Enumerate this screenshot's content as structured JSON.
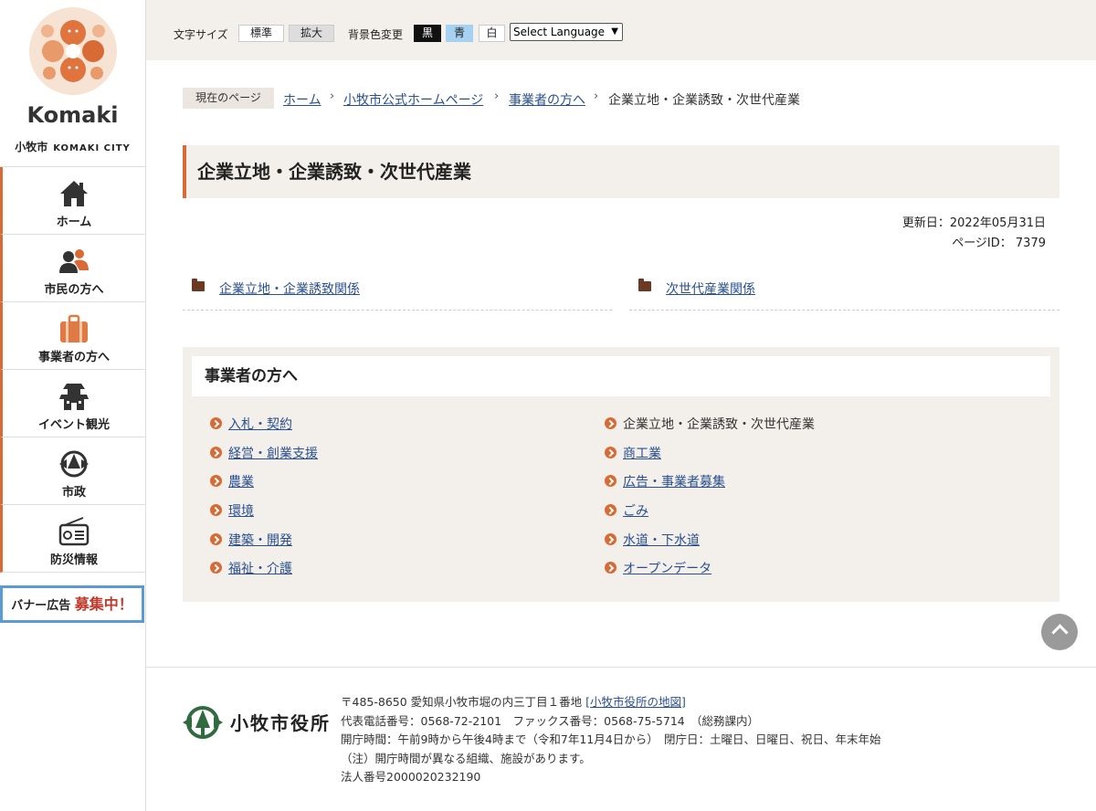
{
  "sidebar": {
    "logo_text": "Komaki",
    "logo_city_ja": "小牧市",
    "logo_city_en": "KOMAKI CITY",
    "nav": [
      {
        "label": "ホーム",
        "icon": "home-icon"
      },
      {
        "label": "市民の方へ",
        "icon": "people-icon"
      },
      {
        "label": "事業者の方へ",
        "icon": "briefcase-icon"
      },
      {
        "label": "イベント観光",
        "icon": "castle-icon"
      },
      {
        "label": "市政",
        "icon": "city-emblem-icon"
      },
      {
        "label": "防災情報",
        "icon": "radio-icon"
      }
    ],
    "banner_prefix": "バナー広告",
    "banner_highlight": "募集中！"
  },
  "topbar": {
    "font_size_label": "文字サイズ",
    "font_standard": "標準",
    "font_large": "拡大",
    "bg_label": "背景色変更",
    "bg_black": "黒",
    "bg_blue": "青",
    "bg_white": "白",
    "language": "Select Language"
  },
  "breadcrumb": {
    "label": "現在のページ",
    "items": [
      "ホーム",
      "小牧市公式ホームページ",
      "事業者の方へ"
    ],
    "current": "企業立地・企業誘致・次世代産業"
  },
  "page": {
    "title": "企業立地・企業誘致・次世代産業",
    "updated": "更新日：2022年05月31日",
    "page_id": "ページID： 7379",
    "folders": [
      "企業立地・企業誘致関係",
      "次世代産業関係"
    ]
  },
  "box": {
    "heading": "事業者の方へ",
    "left": [
      "入札・契約",
      "経営・創業支援",
      "農業",
      "環境",
      "建築・開発",
      "福祉・介護"
    ],
    "right": [
      "企業立地・企業誘致・次世代産業",
      "商工業",
      "広告・事業者募集",
      "ごみ",
      "水道・下水道",
      "オープンデータ"
    ]
  },
  "footer": {
    "name": "小牧市役所",
    "address": "〒485-8650 愛知県小牧市堀の内三丁目１番地",
    "map_link": "[小牧市役所の地図]",
    "phone": "代表電話番号：0568-72-2101　ファックス番号：0568-75-5714　（総務課内）",
    "hours": "開庁時間：午前9時から午後4時まで（令和7年11月4日から）　閉庁日：土曜日、日曜日、祝日、年末年始",
    "note": "（注）開庁時間が異なる組織、施設があります。",
    "corp": "法人番号2000020232190"
  },
  "colors": {
    "accent": "#d86b35",
    "bg_beige": "#f3f0eb",
    "link": "#2a4f8f"
  }
}
